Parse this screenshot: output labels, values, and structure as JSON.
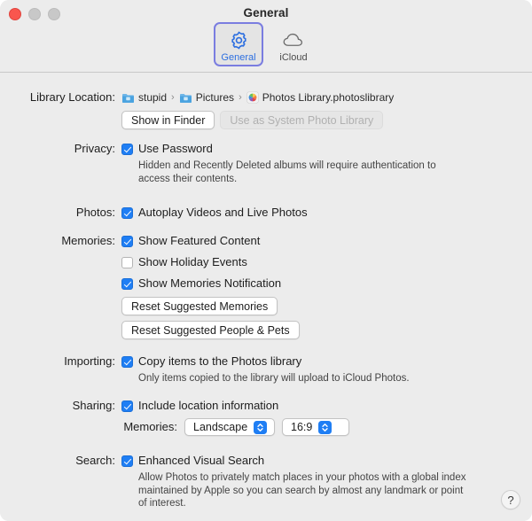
{
  "window": {
    "title": "General",
    "traffic_lights": [
      "close",
      "minimize",
      "maximize"
    ]
  },
  "toolbar": {
    "tabs": [
      {
        "label": "General",
        "icon": "gear-icon",
        "selected": true
      },
      {
        "label": "iCloud",
        "icon": "cloud-icon",
        "selected": false
      }
    ]
  },
  "sections": {
    "library_location": {
      "label": "Library Location:",
      "breadcrumb": [
        {
          "text": "stupid",
          "icon": "folder-icon"
        },
        {
          "text": "Pictures",
          "icon": "folder-icon"
        },
        {
          "text": "Photos Library.photoslibrary",
          "icon": "photos-library-icon"
        }
      ],
      "separator": "›",
      "buttons": [
        {
          "label": "Show in Finder",
          "disabled": false
        },
        {
          "label": "Use as System Photo Library",
          "disabled": true
        }
      ]
    },
    "privacy": {
      "label": "Privacy:",
      "checkbox": {
        "label": "Use Password",
        "checked": true
      },
      "description": "Hidden and Recently Deleted albums will require authentication to access their contents."
    },
    "photos": {
      "label": "Photos:",
      "checkbox": {
        "label": "Autoplay Videos and Live Photos",
        "checked": true
      }
    },
    "memories": {
      "label": "Memories:",
      "checkboxes": [
        {
          "label": "Show Featured Content",
          "checked": true
        },
        {
          "label": "Show Holiday Events",
          "checked": false
        },
        {
          "label": "Show Memories Notification",
          "checked": true
        }
      ],
      "buttons": [
        {
          "label": "Reset Suggested Memories"
        },
        {
          "label": "Reset Suggested People & Pets"
        }
      ]
    },
    "importing": {
      "label": "Importing:",
      "checkbox": {
        "label": "Copy items to the Photos library",
        "checked": true
      },
      "description": "Only items copied to the library will upload to iCloud Photos."
    },
    "sharing": {
      "label": "Sharing:",
      "checkbox": {
        "label": "Include location information",
        "checked": true
      },
      "memories_label": "Memories:",
      "orientation_select": {
        "value": "Landscape"
      },
      "aspect_select": {
        "value": "16:9"
      }
    },
    "search": {
      "label": "Search:",
      "checkbox": {
        "label": "Enhanced Visual Search",
        "checked": true
      },
      "description": "Allow Photos to privately match places in your photos with a global index maintained by Apple so you can search by almost any landmark or point of interest."
    }
  },
  "help_button": {
    "label": "?"
  },
  "colors": {
    "accent": "#1f7ef4",
    "selected_tab_border": "#7a7de0",
    "selected_tab_text": "#2d6fe0",
    "window_bg": "#ececec"
  }
}
